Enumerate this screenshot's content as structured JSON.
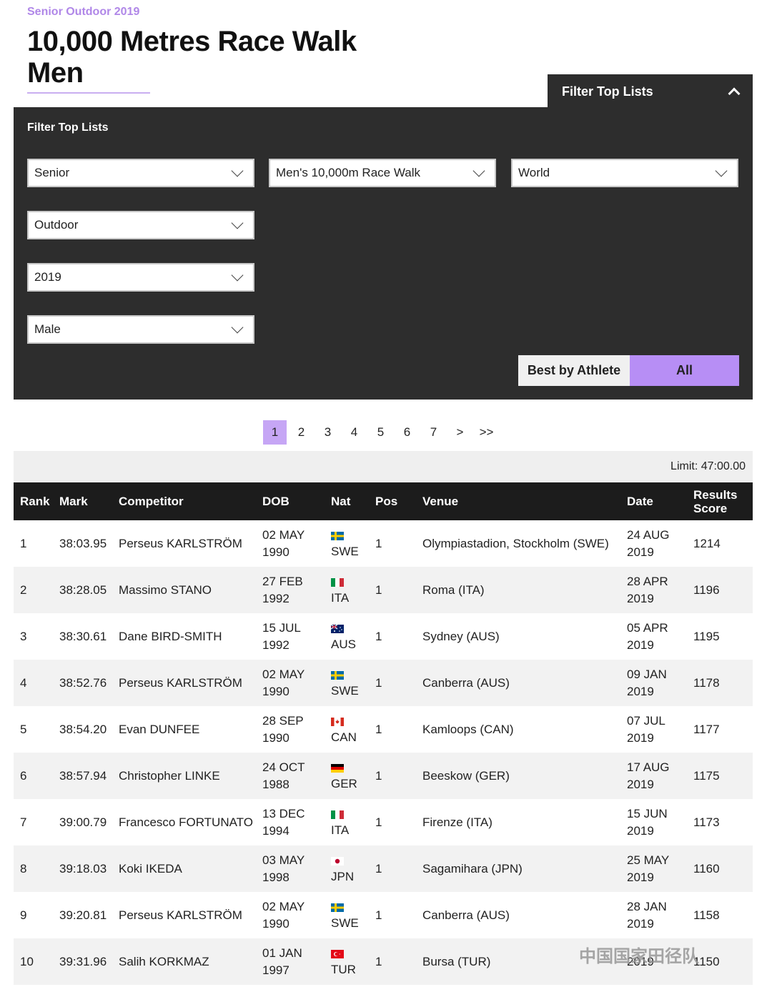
{
  "header": {
    "subtitle": "Senior Outdoor 2019",
    "title": "10,000 Metres Race Walk Men"
  },
  "filter_tab": {
    "label": "Filter Top Lists"
  },
  "filter_panel": {
    "title": "Filter Top Lists",
    "selects": {
      "age": "Senior",
      "discipline": "Men's 10,000m Race Walk",
      "region": "World",
      "environment": "Outdoor",
      "year": "2019",
      "gender": "Male"
    },
    "toggle": {
      "best_by_athlete": "Best by Athlete",
      "all": "All",
      "selected": "All"
    }
  },
  "pagination": {
    "pages": [
      "1",
      "2",
      "3",
      "4",
      "5",
      "6",
      "7"
    ],
    "next": ">",
    "last": ">>",
    "current": "1"
  },
  "limit": "Limit: 47:00.00",
  "table": {
    "headers": {
      "rank": "Rank",
      "mark": "Mark",
      "competitor": "Competitor",
      "dob": "DOB",
      "nat": "Nat",
      "pos": "Pos",
      "venue": "Venue",
      "date": "Date",
      "score_line1": "Results",
      "score_line2": "Score"
    },
    "rows": [
      {
        "rank": "1",
        "mark": "38:03.95",
        "competitor": "Perseus KARLSTRÖM",
        "dob_day": "02 MAY",
        "dob_year": "1990",
        "nat": "SWE",
        "pos": "1",
        "venue": "Olympiastadion, Stockholm (SWE)",
        "date_day": "24 AUG",
        "date_year": "2019",
        "score": "1214"
      },
      {
        "rank": "2",
        "mark": "38:28.05",
        "competitor": "Massimo STANO",
        "dob_day": "27 FEB",
        "dob_year": "1992",
        "nat": "ITA",
        "pos": "1",
        "venue": "Roma (ITA)",
        "date_day": "28 APR",
        "date_year": "2019",
        "score": "1196"
      },
      {
        "rank": "3",
        "mark": "38:30.61",
        "competitor": "Dane BIRD-SMITH",
        "dob_day": "15 JUL",
        "dob_year": "1992",
        "nat": "AUS",
        "pos": "1",
        "venue": "Sydney (AUS)",
        "date_day": "05 APR",
        "date_year": "2019",
        "score": "1195"
      },
      {
        "rank": "4",
        "mark": "38:52.76",
        "competitor": "Perseus KARLSTRÖM",
        "dob_day": "02 MAY",
        "dob_year": "1990",
        "nat": "SWE",
        "pos": "1",
        "venue": "Canberra (AUS)",
        "date_day": "09 JAN",
        "date_year": "2019",
        "score": "1178"
      },
      {
        "rank": "5",
        "mark": "38:54.20",
        "competitor": "Evan DUNFEE",
        "dob_day": "28 SEP",
        "dob_year": "1990",
        "nat": "CAN",
        "pos": "1",
        "venue": "Kamloops (CAN)",
        "date_day": "07 JUL",
        "date_year": "2019",
        "score": "1177"
      },
      {
        "rank": "6",
        "mark": "38:57.94",
        "competitor": "Christopher LINKE",
        "dob_day": "24 OCT",
        "dob_year": "1988",
        "nat": "GER",
        "pos": "1",
        "venue": "Beeskow (GER)",
        "date_day": "17 AUG",
        "date_year": "2019",
        "score": "1175"
      },
      {
        "rank": "7",
        "mark": "39:00.79",
        "competitor": "Francesco FORTUNATO",
        "dob_day": "13 DEC",
        "dob_year": "1994",
        "nat": "ITA",
        "pos": "1",
        "venue": "Firenze (ITA)",
        "date_day": "15 JUN",
        "date_year": "2019",
        "score": "1173"
      },
      {
        "rank": "8",
        "mark": "39:18.03",
        "competitor": "Koki IKEDA",
        "dob_day": "03 MAY",
        "dob_year": "1998",
        "nat": "JPN",
        "pos": "1",
        "venue": "Sagamihara (JPN)",
        "date_day": "25 MAY",
        "date_year": "2019",
        "score": "1160"
      },
      {
        "rank": "9",
        "mark": "39:20.81",
        "competitor": "Perseus KARLSTRÖM",
        "dob_day": "02 MAY",
        "dob_year": "1990",
        "nat": "SWE",
        "pos": "1",
        "venue": "Canberra (AUS)",
        "date_day": "28 JAN",
        "date_year": "2019",
        "score": "1158"
      },
      {
        "rank": "10",
        "mark": "39:31.96",
        "competitor": "Salih KORKMAZ",
        "dob_day": "01 JAN",
        "dob_year": "1997",
        "nat": "TUR",
        "pos": "1",
        "venue": "Bursa (TUR)",
        "date_day": "",
        "date_year": "2019",
        "score": "1150"
      }
    ]
  },
  "watermark": "中国国家田径队",
  "colors": {
    "accent": "#b78ef5",
    "panel_bg": "#2d2d2d",
    "header_bg": "#1c1c1c",
    "row_alt": "#f2f2f2"
  }
}
